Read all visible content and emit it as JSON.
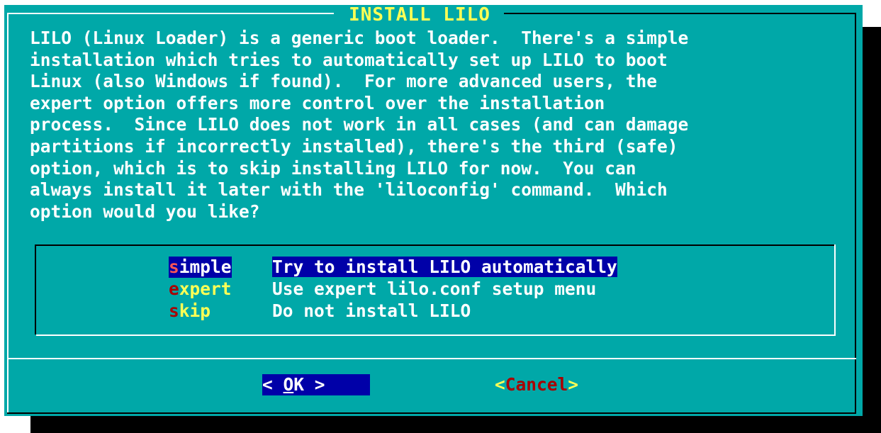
{
  "dialog": {
    "title": "INSTALL LILO",
    "message": "LILO (Linux Loader) is a generic boot loader.  There's a simple\ninstallation which tries to automatically set up LILO to boot\nLinux (also Windows if found).  For more advanced users, the\nexpert option offers more control over the installation\nprocess.  Since LILO does not work in all cases (and can damage\npartitions if incorrectly installed), there's the third (safe)\noption, which is to skip installing LILO for now.  You can\nalways install it later with the 'liloconfig' command.  Which\noption would you like?"
  },
  "menu": {
    "items": [
      {
        "tag_hot": "s",
        "tag_rest": "imple",
        "description": "Try to install LILO automatically",
        "selected": true
      },
      {
        "tag_hot": "e",
        "tag_rest": "xpert",
        "description": "Use expert lilo.conf setup menu",
        "selected": false
      },
      {
        "tag_hot": "s",
        "tag_rest": "kip",
        "description": "Do not install LILO",
        "selected": false
      }
    ]
  },
  "buttons": {
    "ok": {
      "left": "<  ",
      "hot": "O",
      "rest": "K",
      "right": "  >",
      "focused": true
    },
    "cancel": {
      "left": "<",
      "hot": "C",
      "rest": "ancel",
      "right": ">",
      "focused": false
    }
  },
  "colors": {
    "dialog_bg": "#00a8a8",
    "selection_bg": "#0000a8",
    "title_fg": "#ffff55",
    "hotkey_fg": "#aa0000",
    "text_fg": "#ffffff",
    "shadow": "#000000"
  }
}
